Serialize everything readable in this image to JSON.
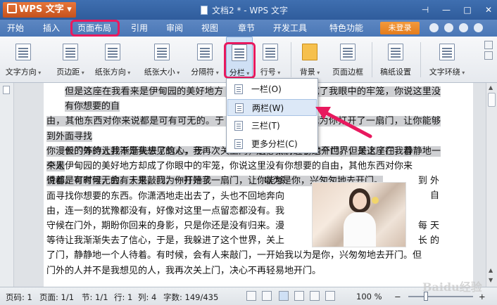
{
  "titlebar": {
    "app_name": "WPS 文字",
    "doc_title": "文档2 * - WPS 文字"
  },
  "menu": {
    "items": [
      "开始",
      "插入",
      "页面布局",
      "引用",
      "审阅",
      "视图",
      "章节",
      "开发工具",
      "特色功能"
    ],
    "active": "页面布局",
    "login_label": "未登录"
  },
  "ribbon": {
    "buttons": [
      "文字方向",
      "页边距",
      "纸张方向",
      "纸张大小",
      "分隔符",
      "分栏",
      "行号",
      "背景",
      "页面边框",
      "稿纸设置",
      "文字环绕"
    ]
  },
  "dropdown": {
    "items": [
      "一栏(O)",
      "两栏(W)",
      "三栏(T)",
      "更多分栏(C)"
    ],
    "hovered": "两栏(W)"
  },
  "document": {
    "para1_lines": [
      "但是这座在我看来是伊甸园的美好地方",
      "却成了我眼中的牢笼，你说这里没有你想要的自",
      "由，其他东西对你来说都是可有可无的。于",
      "是，我为你打开了一扇门，让你能够到外面寻找",
      "你漫长的等待让我渐渐失去了信心，于",
      "是，我解进了这个世界，关上了门，静静地一个人",
      "待着。有时候，会有人来敲门，一开始我",
      "以为是你，兴匆匆地去开门。"
    ],
    "para2_lines": [
      "但门外的人并不是我想见的人，我再次关上门，决心不再轻易地开门。但是这座在我看",
      "来是伊甸园的美好地方却成了你眼中的牢笼，你说这里没有你想要的自由，其他东西对你来",
      "说都是可有可无的。于是，我为你打开了一扇门，让你能够",
      "面寻找你想要的东西。你潇洒地走出去了，头也不回地奔向",
      "由，连一刻的犹豫都没有，好像对这里一点留恋都没有。我",
      "守候在门外，期盼你回来的身影，只是你还是没有归来。漫",
      "等待让我渐渐失去了信心，于是，我躲进了这个世界，关上",
      "了门，静静地一个人待着。有时候，会有人来敲门，一开始我以为是你，兴匆匆地去开门。但",
      "门外的人并不是我想见的人，我再次关上门，决心不再轻易地开门。"
    ],
    "right_fragments": [
      "到 外",
      "自",
      "每 天",
      "长 的"
    ]
  },
  "statusbar": {
    "page_code": "页码: 1",
    "page": "页面: 1/1",
    "section": "节: 1/1",
    "row": "行: 1",
    "col": "列: 4",
    "word_count": "字数: 149/435",
    "zoom": "100 %"
  },
  "colors": {
    "title_bg": "#3f6fb0",
    "menu_bg": "#5d87c2",
    "highlight": "#e8195e",
    "login_bg": "#f39a3d",
    "selection": "#cfd0d3"
  },
  "watermark": "Baidu经验"
}
